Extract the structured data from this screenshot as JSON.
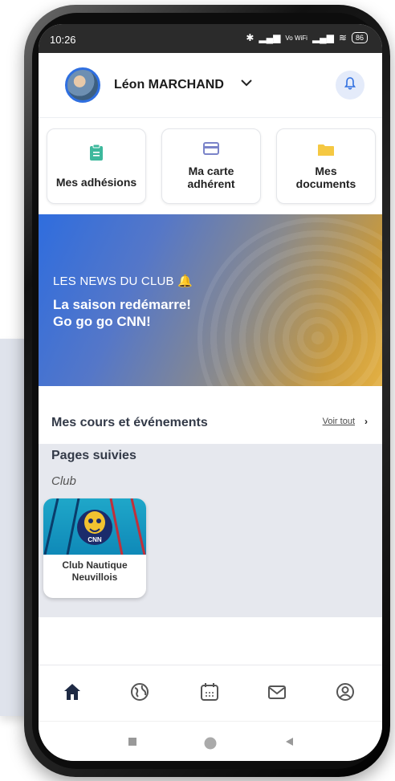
{
  "status_bar": {
    "time": "10:26",
    "network": "Vo WiFi",
    "battery": "86"
  },
  "header": {
    "user_name": "Léon MARCHAND"
  },
  "shortcuts": [
    {
      "label_line1": "Mes adhésions",
      "label_line2": "",
      "icon": "clipboard-icon"
    },
    {
      "label_line1": "Ma carte",
      "label_line2": "adhérent",
      "icon": "card-icon"
    },
    {
      "label_line1": "Mes",
      "label_line2": "documents",
      "icon": "folder-icon"
    }
  ],
  "news": {
    "kicker": "LES NEWS DU CLUB 🔔",
    "headline_line1": "La saison redémarre!",
    "headline_line2": "Go go go CNN!"
  },
  "events": {
    "title": "Mes cours et événements",
    "see_all": "Voir tout"
  },
  "followed_pages": {
    "title": "Pages suivies",
    "category": "Club",
    "items": [
      {
        "name_line1": "Club Nautique",
        "name_line2": "Neuvillois",
        "logo_text": "CNN"
      }
    ]
  },
  "bottom_nav": [
    "home-icon",
    "globe-icon",
    "calendar-icon",
    "mail-icon",
    "profile-icon"
  ],
  "colors": {
    "accent": "#2f6fe0",
    "icon_green": "#3db89c",
    "icon_purple": "#7b84c9",
    "icon_yellow": "#f5c842",
    "nav_active": "#1e2a44"
  }
}
